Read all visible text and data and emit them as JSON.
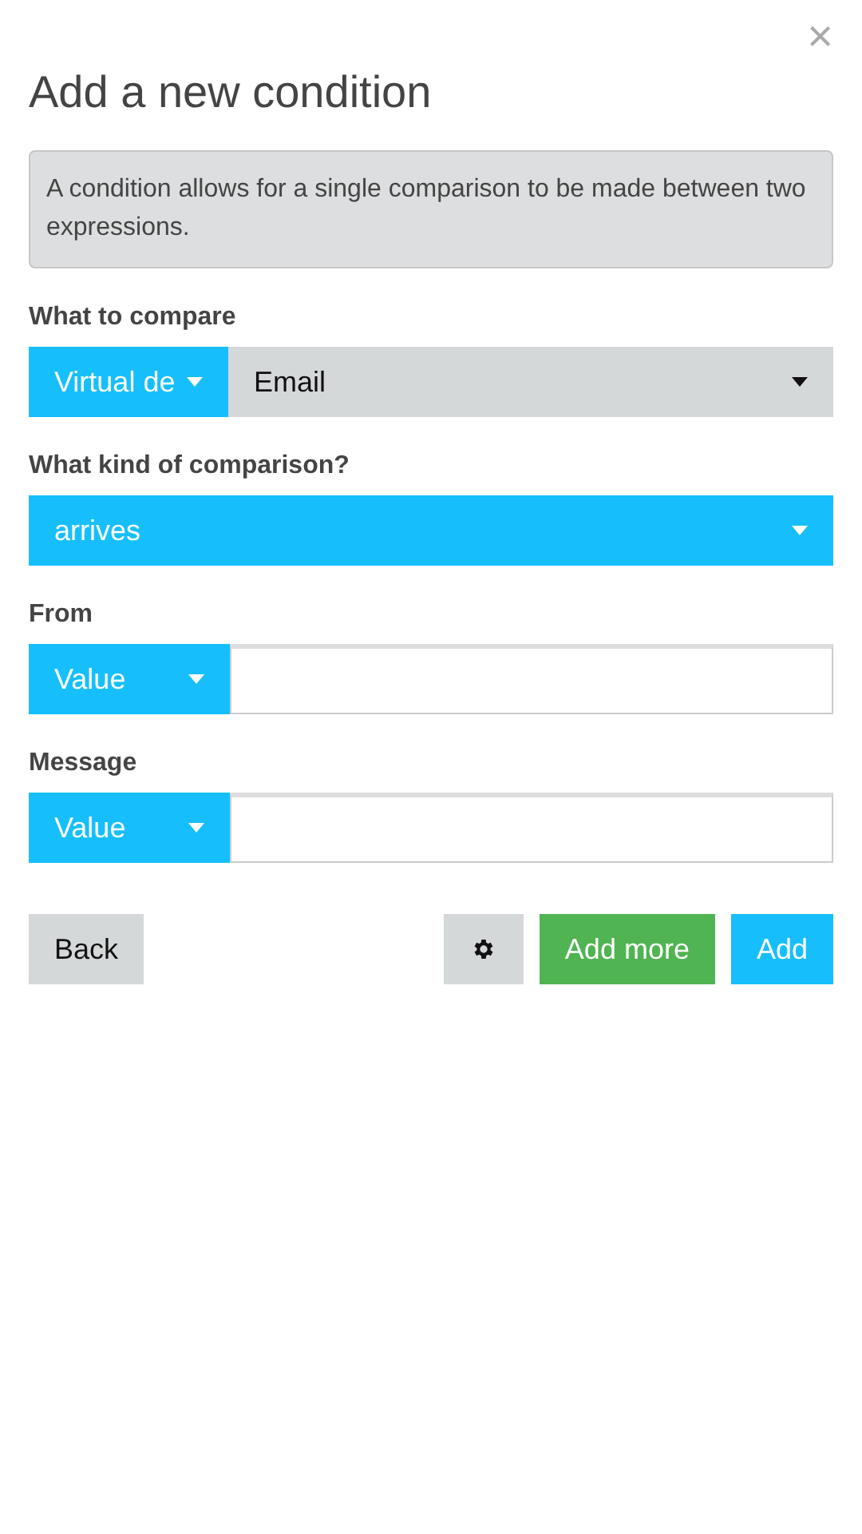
{
  "title": "Add a new condition",
  "close": "×",
  "info": "A condition allows for a single comparison to be made between two expressions.",
  "fields": [
    {
      "kind": "split",
      "label": "What to compare",
      "type": "Virtual de",
      "value": "Email"
    },
    {
      "kind": "select",
      "label": "What kind of comparison?",
      "value": "arrives"
    },
    {
      "kind": "input",
      "label": "From",
      "type": "Value"
    },
    {
      "kind": "input",
      "label": "Message",
      "type": "Value"
    }
  ],
  "buttons": [
    {
      "kind": "back",
      "label": "Back"
    },
    {
      "kind": "settings"
    },
    {
      "kind": "add-more",
      "label": "Add more"
    },
    {
      "kind": "add",
      "label": "Add"
    }
  ]
}
